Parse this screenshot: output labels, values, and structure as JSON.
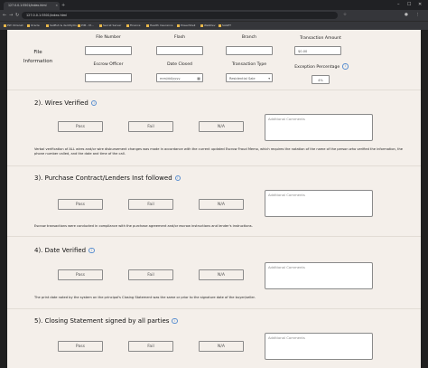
{
  "browser": {
    "tab_title": "127.0.0.1:5501/index.html",
    "tab_close": "×",
    "new_tab": "+",
    "url": "127.0.0.1:5501/index.html",
    "bookmarks": [
      "PW Intranet",
      "Oracle",
      "Sailfish & dentityOn...",
      "PIM - M...",
      "Secret Server",
      "Finance",
      "Health Insurance",
      "PowerShell",
      "WebDev",
      "SAGET"
    ]
  },
  "file_information": {
    "heading": "File Information",
    "file_number_label": "File Number",
    "file_number_value": "",
    "flash_label": "Flash",
    "flash_value": "",
    "branch_label": "Branch",
    "branch_value": "",
    "transaction_amount_label": "Transaction Amount",
    "transaction_amount_value": "$0.00",
    "escrow_officer_label": "Escrow Officer",
    "escrow_officer_value": "",
    "date_closed_label": "Date Closed",
    "date_closed_value": "mm/dd/yyyy",
    "transaction_type_label": "Transaction Type",
    "transaction_type_value": "Residential Sale",
    "exception_percentage_label": "Exception Percentage",
    "exception_percentage_value": "4%"
  },
  "sections": [
    {
      "title": "2). Wires Verified",
      "pass": "Pass",
      "fail": "Fail",
      "na": "N/A",
      "comments_placeholder": "Additional Comments",
      "description": "Verbal verification of ALL wires and/or wire disbursement changes was made in accordance with the current updated Escrow Fraud Memo, which requires the notation of the name of the person who verified the information, the phone number called, and the date and time of the call."
    },
    {
      "title": "3). Purchase Contract/Lenders Inst followed",
      "pass": "Pass",
      "fail": "Fail",
      "na": "N/A",
      "comments_placeholder": "Additional Comments",
      "description": "Escrow transactions were conducted in compliance with the purchase agreement and/or escrow instructions and lender's instructions."
    },
    {
      "title": "4). Date Verified",
      "pass": "Pass",
      "fail": "Fail",
      "na": "N/A",
      "comments_placeholder": "Additional Comments",
      "description": "The print date noted by the system on the principal's Closing Statement was the same or prior to the signature date of the buyer/seller."
    },
    {
      "title": "5). Closing Statement signed by all parties",
      "pass": "Pass",
      "fail": "Fail",
      "na": "N/A",
      "comments_placeholder": "Additional Comments",
      "description": ""
    }
  ],
  "icons": {
    "info": "info-circle-icon",
    "calendar": "calendar-icon",
    "dropdown": "chevron-down-icon"
  },
  "colors": {
    "page_bg": "#f4efea",
    "info_icon": "#5a8fd0"
  }
}
